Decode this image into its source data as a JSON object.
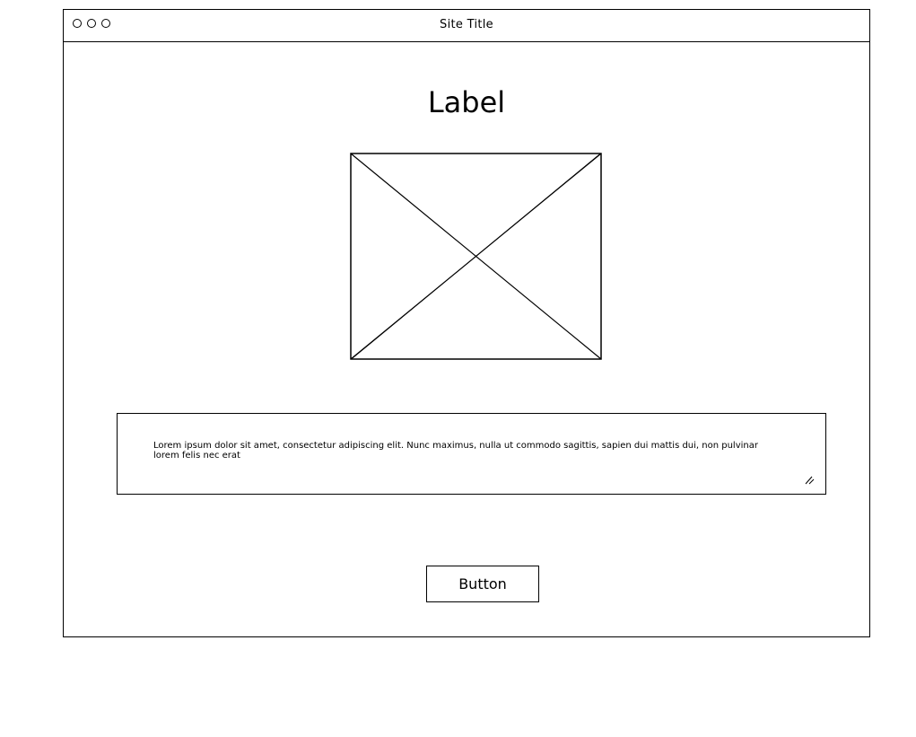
{
  "window": {
    "site_title": "Site Title"
  },
  "main": {
    "heading": "Label",
    "image_icon": "image-placeholder-icon",
    "text_area": {
      "value": "Lorem ipsum dolor sit amet, consectetur adipiscing elit. Nunc maximus, nulla ut commodo sagittis, sapien dui mattis dui, non pulvinar lorem felis nec erat"
    },
    "button_label": "Button"
  }
}
